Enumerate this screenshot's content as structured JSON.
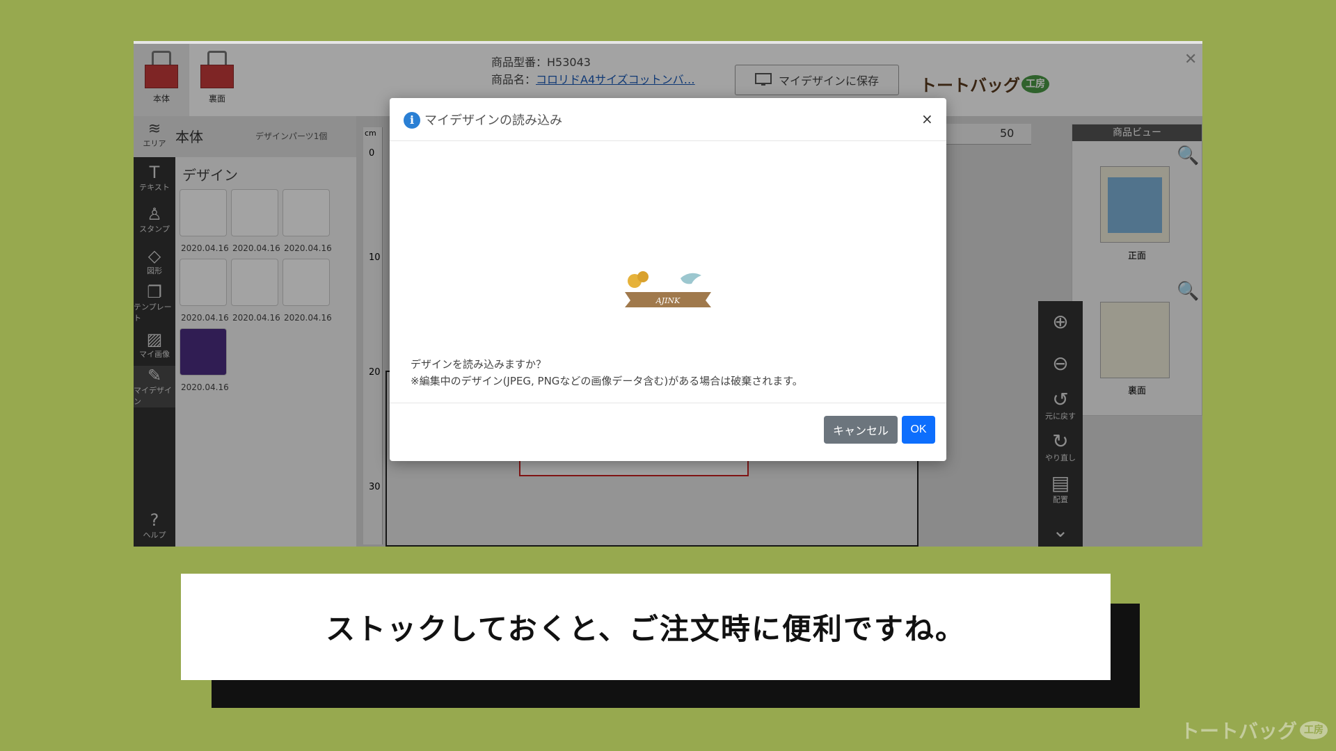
{
  "product_tabs": [
    {
      "label": "本体"
    },
    {
      "label": "裏面"
    }
  ],
  "product_info": {
    "model_label": "商品型番：H53043",
    "name_prefix": "商品名：",
    "name_link": "コロリドA4サイズコットンバ…"
  },
  "save_button": {
    "label": "マイデザインに保存"
  },
  "logo": {
    "text": "トートバッグ",
    "badge": "工房"
  },
  "area_bar": {
    "icon_label": "エリア",
    "title": "本体",
    "parts_label": "デザインパーツ1個"
  },
  "tools": [
    {
      "icon": "T",
      "label": "テキスト"
    },
    {
      "icon": "♙",
      "label": "スタンプ"
    },
    {
      "icon": "◇",
      "label": "図形"
    },
    {
      "icon": "❐",
      "label": "テンプレート"
    },
    {
      "icon": "▨",
      "label": "マイ画像"
    },
    {
      "icon": "✎",
      "label": "マイデザイン"
    },
    {
      "icon": "?",
      "label": "ヘルプ"
    }
  ],
  "design_panel": {
    "heading": "デザイン",
    "dates": [
      "2020.04.16",
      "2020.04.16",
      "2020.04.16",
      "2020.04.16",
      "2020.04.16",
      "2020.04.16",
      "2020.04.16"
    ]
  },
  "ruler": {
    "unit": "cm",
    "h_label": "50",
    "v_labels": [
      "0",
      "10",
      "20",
      "30"
    ]
  },
  "product_view": {
    "title": "商品ビュー",
    "front_label": "正面",
    "back_label": "裏面"
  },
  "zoom_tools": [
    {
      "icon": "⊕",
      "label": ""
    },
    {
      "icon": "⊖",
      "label": ""
    },
    {
      "icon": "↺",
      "label": "元に戻す"
    },
    {
      "icon": "↻",
      "label": "やり直し"
    },
    {
      "icon": "▤",
      "label": "配置"
    },
    {
      "icon": "⌄",
      "label": ""
    }
  ],
  "modal": {
    "title": "マイデザインの読み込み",
    "close": "×",
    "preview_text": "AJINK",
    "message_line1": "デザインを読み込みますか？",
    "message_line2": "※編集中のデザイン(JPEG, PNGなどの画像データ含む)がある場合は破棄されます。",
    "cancel_label": "キャンセル",
    "ok_label": "OK"
  },
  "caption": "ストックしておくと、ご注文時に便利ですね。",
  "watermark": {
    "text": "トートバッグ",
    "badge": "工房"
  },
  "colors": {
    "background": "#97a94f",
    "ok": "#0d6efd",
    "cancel": "#6c757d",
    "bag": "#c53a3a"
  }
}
